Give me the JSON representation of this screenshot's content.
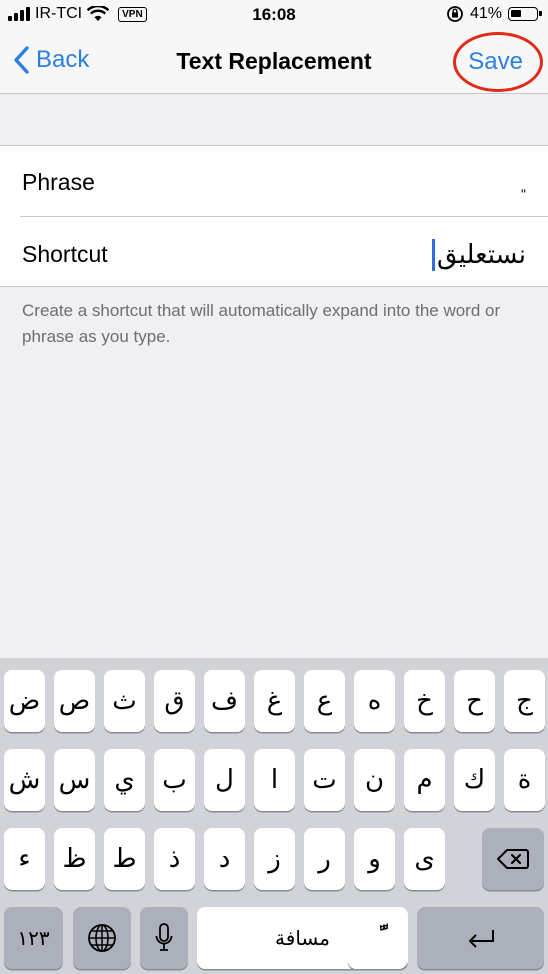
{
  "status_bar": {
    "carrier": "IR-TCI",
    "vpn": "VPN",
    "time": "16:08",
    "battery": "41%",
    "battery_level": 0.41
  },
  "nav": {
    "back_label": "Back",
    "title": "Text Replacement",
    "save_label": "Save",
    "accent_color": "#2d7fe0",
    "highlight_color": "#e32a17"
  },
  "form": {
    "phrase_label": "Phrase",
    "phrase_value": "\"",
    "shortcut_label": "Shortcut",
    "shortcut_value": "نستعليق"
  },
  "hint": "Create a shortcut that will automatically expand into the word or phrase as you type.",
  "keyboard": {
    "row1": [
      "ض",
      "ص",
      "ث",
      "ق",
      "ف",
      "غ",
      "ع",
      "ه",
      "خ",
      "ح",
      "ج"
    ],
    "row2": [
      "ش",
      "س",
      "ي",
      "ب",
      "ل",
      "ا",
      "ت",
      "ن",
      "م",
      "ك",
      "ة"
    ],
    "row3": [
      "ء",
      "ظ",
      "ط",
      "ذ",
      "د",
      "ز",
      "ر",
      "و",
      "ى"
    ],
    "numbers_label": "١٢٣",
    "space_label": "مسافة",
    "diacritic_label": "ًّ",
    "icons": {
      "backspace": "backspace-icon",
      "globe": "globe-icon",
      "mic": "microphone-icon",
      "return": "return-icon"
    }
  }
}
